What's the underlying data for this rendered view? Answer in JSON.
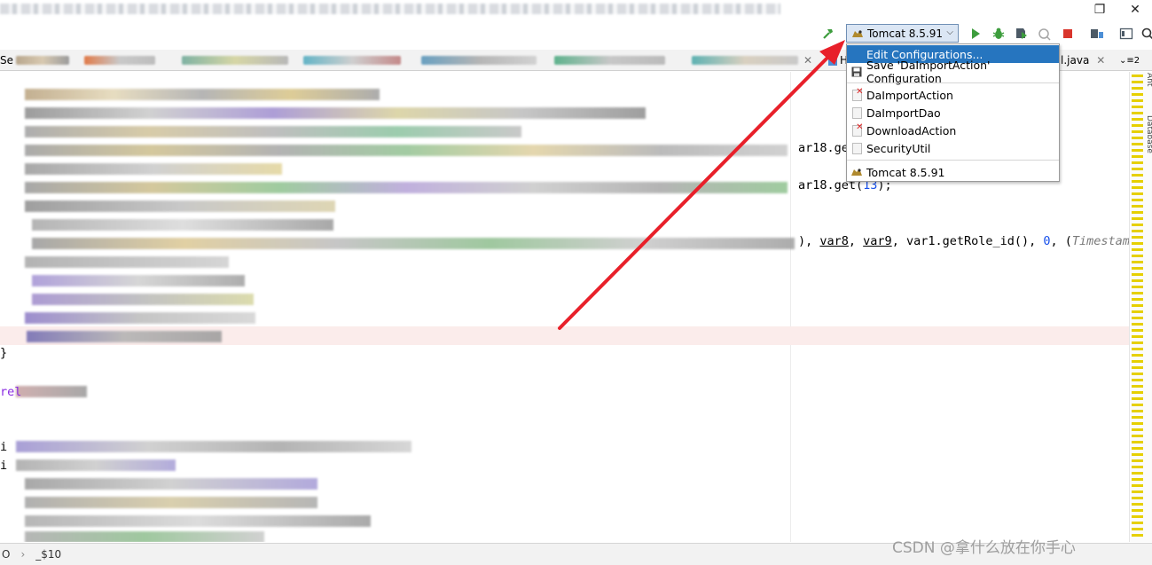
{
  "window": {
    "restore_icon": "restore-window-icon",
    "close_icon": "close-window-icon"
  },
  "toolbar": {
    "build_icon": "hammer-icon",
    "run_config_label": "Tomcat 8.5.91",
    "run_config_icon": "tomcat-icon",
    "run_icon": "run-icon",
    "debug_icon": "debug-icon",
    "coverage_icon": "coverage-icon",
    "profile_icon": "profile-icon",
    "stop_icon": "stop-icon",
    "project_structure_icon": "project-structure-icon",
    "search_icon": "search-icon"
  },
  "tabs": {
    "first_partial": "Se",
    "right_partial_h": "H",
    "right_file": "l.java",
    "overflow_count": "2"
  },
  "dropdown": {
    "items": [
      {
        "label": "Edit Configurations...",
        "icon": "none",
        "selected": true
      },
      {
        "label": "Save 'DaImportAction' Configuration",
        "icon": "save-icon",
        "selected": false
      },
      {
        "label": "DaImportAction",
        "icon": "java-class-error-icon",
        "selected": false
      },
      {
        "label": "DaImportDao",
        "icon": "java-class-icon",
        "selected": false
      },
      {
        "label": "DownloadAction",
        "icon": "java-class-error-icon",
        "selected": false
      },
      {
        "label": "SecurityUtil",
        "icon": "java-class-icon",
        "selected": false
      },
      {
        "label": "Tomcat 8.5.91",
        "icon": "tomcat-icon",
        "selected": false
      }
    ]
  },
  "editor": {
    "line_a_prefix": "ar18.ge",
    "line_b_prefix": "ar18.get(",
    "line_b_num": "13",
    "line_b_suffix": ");",
    "line_c_pre": "), ",
    "line_c_var8": "var8",
    "line_c_sep1": ", ",
    "line_c_var9": "var9",
    "line_c_mid": ", var1.getRole_id(), ",
    "line_c_zero": "0",
    "line_c_comma": ", (",
    "line_c_ts": "Timestamp",
    "line_c_ellipsis": "…",
    "brace": "}",
    "partial_1": "rel",
    "partial_2": "i",
    "partial_3": "i"
  },
  "right_panel": {
    "database_label": "Database",
    "ant_label": "Ant"
  },
  "statusbar": {
    "breadcrumb_first": "O",
    "breadcrumb_sep": "›",
    "breadcrumb_second": "_$10"
  },
  "watermark": "CSDN @拿什么放在你手心",
  "colors": {
    "selection": "#2675bf",
    "arrow": "#e8202a",
    "run_green": "#3d9d3d",
    "stop_red": "#d9352c",
    "highlight_line": "#fbeceb"
  }
}
